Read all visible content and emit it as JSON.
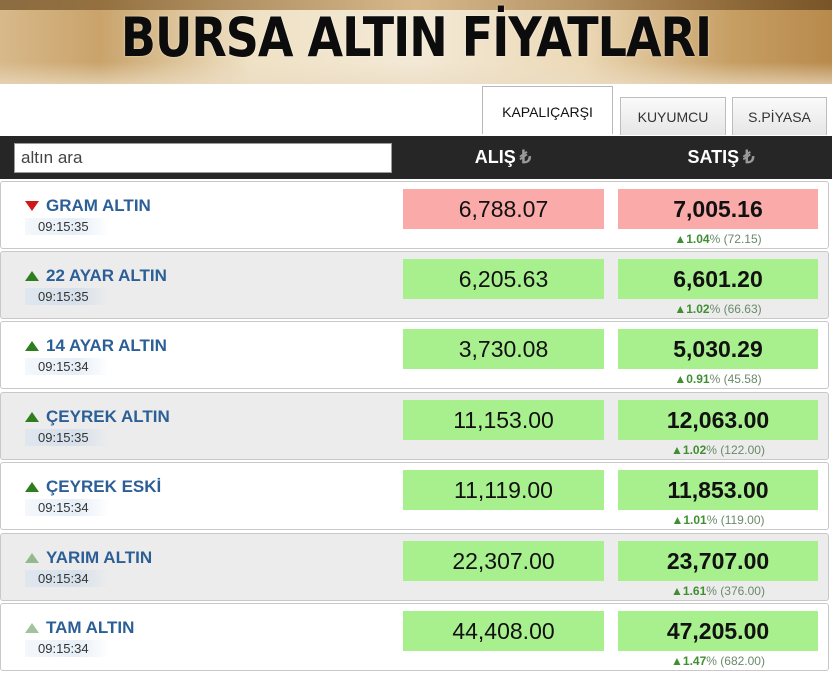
{
  "banner": {
    "title": "BURSA ALTIN FİYATLARI"
  },
  "tabs": [
    {
      "label": "KAPALIÇARŞI",
      "active": true
    },
    {
      "label": "KUYUMCU",
      "active": false
    },
    {
      "label": "S.PİYASA",
      "active": false
    }
  ],
  "header": {
    "search_placeholder": "altın ara",
    "alis_label": "ALIŞ",
    "satis_label": "SATIŞ",
    "currency_symbol": "₺"
  },
  "colors": {
    "up_box": "#a8f08e",
    "down_box": "#fbaaaa",
    "header_bg": "#262626",
    "name_text": "#2b5f96"
  },
  "rows": [
    {
      "name": "GRAM ALTIN",
      "time": "09:15:35",
      "alis": "6,788.07",
      "satis": "7,005.16",
      "change_pct": "1.04",
      "change_abs": "72.15",
      "trend": "down",
      "indicator_icon": "red-down-arrow-icon"
    },
    {
      "name": "22 AYAR ALTIN",
      "time": "09:15:35",
      "alis": "6,205.63",
      "satis": "6,601.20",
      "change_pct": "1.02",
      "change_abs": "66.63",
      "trend": "up",
      "indicator_icon": "green-up-arrow-icon"
    },
    {
      "name": "14 AYAR ALTIN",
      "time": "09:15:34",
      "alis": "3,730.08",
      "satis": "5,030.29",
      "change_pct": "0.91",
      "change_abs": "45.58",
      "trend": "up",
      "indicator_icon": "green-up-arrow-icon"
    },
    {
      "name": "ÇEYREK ALTIN",
      "time": "09:15:35",
      "alis": "11,153.00",
      "satis": "12,063.00",
      "change_pct": "1.02",
      "change_abs": "122.00",
      "trend": "up",
      "indicator_icon": "green-up-arrow-icon"
    },
    {
      "name": "ÇEYREK ESKİ",
      "time": "09:15:34",
      "alis": "11,119.00",
      "satis": "11,853.00",
      "change_pct": "1.01",
      "change_abs": "119.00",
      "trend": "up",
      "indicator_icon": "green-up-arrow-icon"
    },
    {
      "name": "YARIM ALTIN",
      "time": "09:15:34",
      "alis": "22,307.00",
      "satis": "23,707.00",
      "change_pct": "1.61",
      "change_abs": "376.00",
      "trend": "up",
      "indicator_icon": "green-up-arrow-icon"
    },
    {
      "name": "TAM ALTIN",
      "time": "09:15:34",
      "alis": "44,408.00",
      "satis": "47,205.00",
      "change_pct": "1.47",
      "change_abs": "682.00",
      "trend": "up",
      "indicator_icon": "green-up-arrow-icon"
    }
  ]
}
